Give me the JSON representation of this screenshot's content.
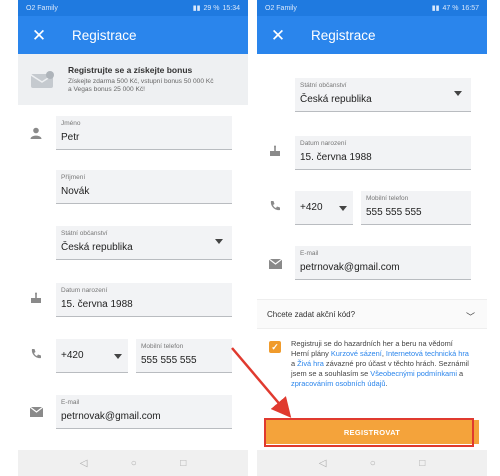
{
  "left_phone": {
    "status": {
      "carrier": "O2 Family",
      "battery": "29 %",
      "time": "15:34"
    },
    "title": "Registrace",
    "bonus": {
      "headline": "Registrujte se a získejte bonus",
      "text_line1": "Získejte zdarma 500 Kč, vstupní bonus 50 000 Kč",
      "text_line2": "a Vegas bonus 25 000 Kč!"
    },
    "fields": {
      "first_name": {
        "label": "Jméno",
        "value": "Petr"
      },
      "last_name": {
        "label": "Příjmení",
        "value": "Novák"
      },
      "citizenship": {
        "label": "Státní občanství",
        "value": "Česká republika"
      },
      "birthdate": {
        "label": "Datum narození",
        "value": "15. června 1988"
      },
      "prefix": {
        "value": "+420"
      },
      "phone": {
        "label": "Mobilní telefon",
        "value": "555 555 555"
      },
      "email": {
        "label": "E-mail",
        "value": "petrnovak@gmail.com"
      }
    }
  },
  "right_phone": {
    "status": {
      "carrier": "O2 Family",
      "battery": "47 %",
      "time": "16:57"
    },
    "title": "Registrace",
    "fields": {
      "citizenship": {
        "label": "Státní občanství",
        "value": "Česká republika"
      },
      "birthdate": {
        "label": "Datum narození",
        "value": "15. června 1988"
      },
      "prefix": {
        "value": "+420"
      },
      "phone": {
        "label": "Mobilní telefon",
        "value": "555 555 555"
      },
      "email": {
        "label": "E-mail",
        "value": "petrnovak@gmail.com"
      }
    },
    "promo_question": "Chcete zadat akční kód?",
    "consent": {
      "part1": "Registruji se do hazardních her a beru na vědomí Herní plány ",
      "link1": "Kurzové sázení",
      "part2": ", ",
      "link2": "Internetová technická hra",
      "part3": " a ",
      "link3": "Živá hra",
      "part4": " závazné pro účast v těchto hrách. Seznámil jsem se a souhlasím se ",
      "link4": "Všeobecnými podmínkami",
      "part5": " a ",
      "link5": "zpracováním osobních údajů",
      "part6": "."
    },
    "register_label": "REGISTROVAT"
  },
  "colors": {
    "appbar": "#2a85ec",
    "accent": "#f4a33b",
    "highlight": "#e03a2f"
  }
}
